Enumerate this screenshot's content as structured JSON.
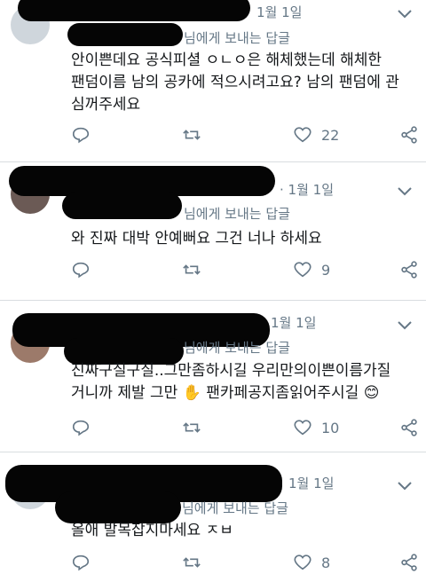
{
  "colors": {
    "icon": "#657786",
    "link": "#1da1f2",
    "text": "#14171a"
  },
  "icons": [
    "reply-icon",
    "retweet-icon",
    "like-icon",
    "share-icon",
    "chevron-down-icon"
  ],
  "tweets": [
    {
      "date": "1월 1일",
      "reply_suffix": "님에게 보내는 답글",
      "text_lines": [
        "안이쁜데요 공식피셜 ㅇㄴㅇ은 해체했는데 해체한",
        "팬덤이름 남의 공카에 적으시려고요? 남의 팬덤에 관",
        "심꺼주세요"
      ],
      "likes": "22"
    },
    {
      "date": "· 1월 1일",
      "reply_suffix": "님에게 보내는 답글",
      "text_lines": [
        "와 진짜 대박 안예뻐요 그건 너나 하세요"
      ],
      "likes": "9"
    },
    {
      "date": "1월 1일",
      "reply_suffix": "님에게 보내는 답글",
      "text_lines": [
        "진짜구질구질..그만좀하시길 우리만의이쁜이름가질",
        "거니까 제발 그만",
        "팬카페공지좀읽어주시길"
      ],
      "emoji_hand": "✋",
      "emoji_smile": "😊",
      "likes": "10"
    },
    {
      "date": "1월 1일",
      "reply_suffix": "님에게 보내는 답글",
      "text_lines": [
        "올애 발목잡지마세요 ㅈㅂ"
      ],
      "likes": "8"
    }
  ]
}
